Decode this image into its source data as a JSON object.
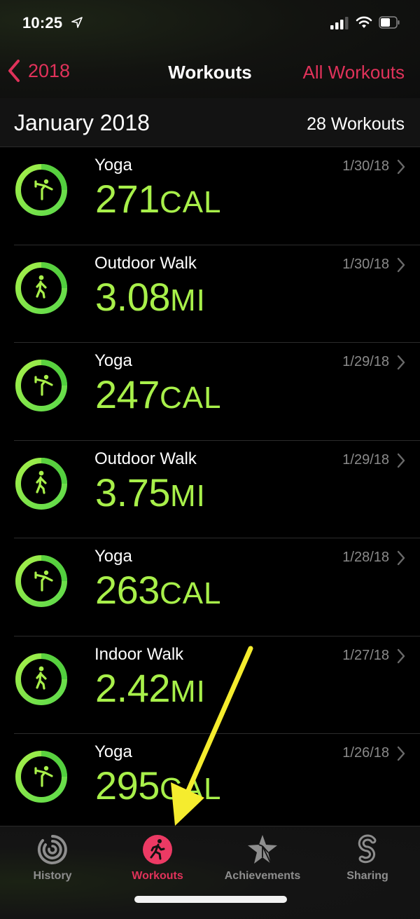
{
  "status_bar": {
    "time": "10:25",
    "icons": [
      "location-arrow-icon",
      "cellular-signal-icon",
      "wifi-icon",
      "battery-icon"
    ]
  },
  "nav": {
    "back_label": "2018",
    "title": "Workouts",
    "right_label": "All Workouts"
  },
  "section": {
    "title": "January 2018",
    "count": "28 Workouts"
  },
  "workouts": [
    {
      "type": "Yoga",
      "icon": "yoga-icon",
      "value": "271",
      "unit": "CAL",
      "date": "1/30/18"
    },
    {
      "type": "Outdoor Walk",
      "icon": "walk-icon",
      "value": "3.08",
      "unit": "MI",
      "date": "1/30/18"
    },
    {
      "type": "Yoga",
      "icon": "yoga-icon",
      "value": "247",
      "unit": "CAL",
      "date": "1/29/18"
    },
    {
      "type": "Outdoor Walk",
      "icon": "walk-icon",
      "value": "3.75",
      "unit": "MI",
      "date": "1/29/18"
    },
    {
      "type": "Yoga",
      "icon": "yoga-icon",
      "value": "263",
      "unit": "CAL",
      "date": "1/28/18"
    },
    {
      "type": "Indoor Walk",
      "icon": "walk-icon",
      "value": "2.42",
      "unit": "MI",
      "date": "1/27/18"
    },
    {
      "type": "Yoga",
      "icon": "yoga-icon",
      "value": "295",
      "unit": "CAL",
      "date": "1/26/18"
    }
  ],
  "tabs": [
    {
      "label": "History",
      "icon": "history-rings-icon",
      "active": false
    },
    {
      "label": "Workouts",
      "icon": "running-figure-icon",
      "active": true
    },
    {
      "label": "Achievements",
      "icon": "star-icon",
      "active": false
    },
    {
      "label": "Sharing",
      "icon": "sharing-s-icon",
      "active": false
    }
  ],
  "colors": {
    "accent": "#e0325a",
    "metric_green": "#a8f04a",
    "ring_green": "#4cd964",
    "annotation_yellow": "#f5ec2e",
    "date_gray": "#8a8a8a"
  },
  "annotation": {
    "type": "yellow-arrow",
    "points_to": "Workouts tab"
  }
}
